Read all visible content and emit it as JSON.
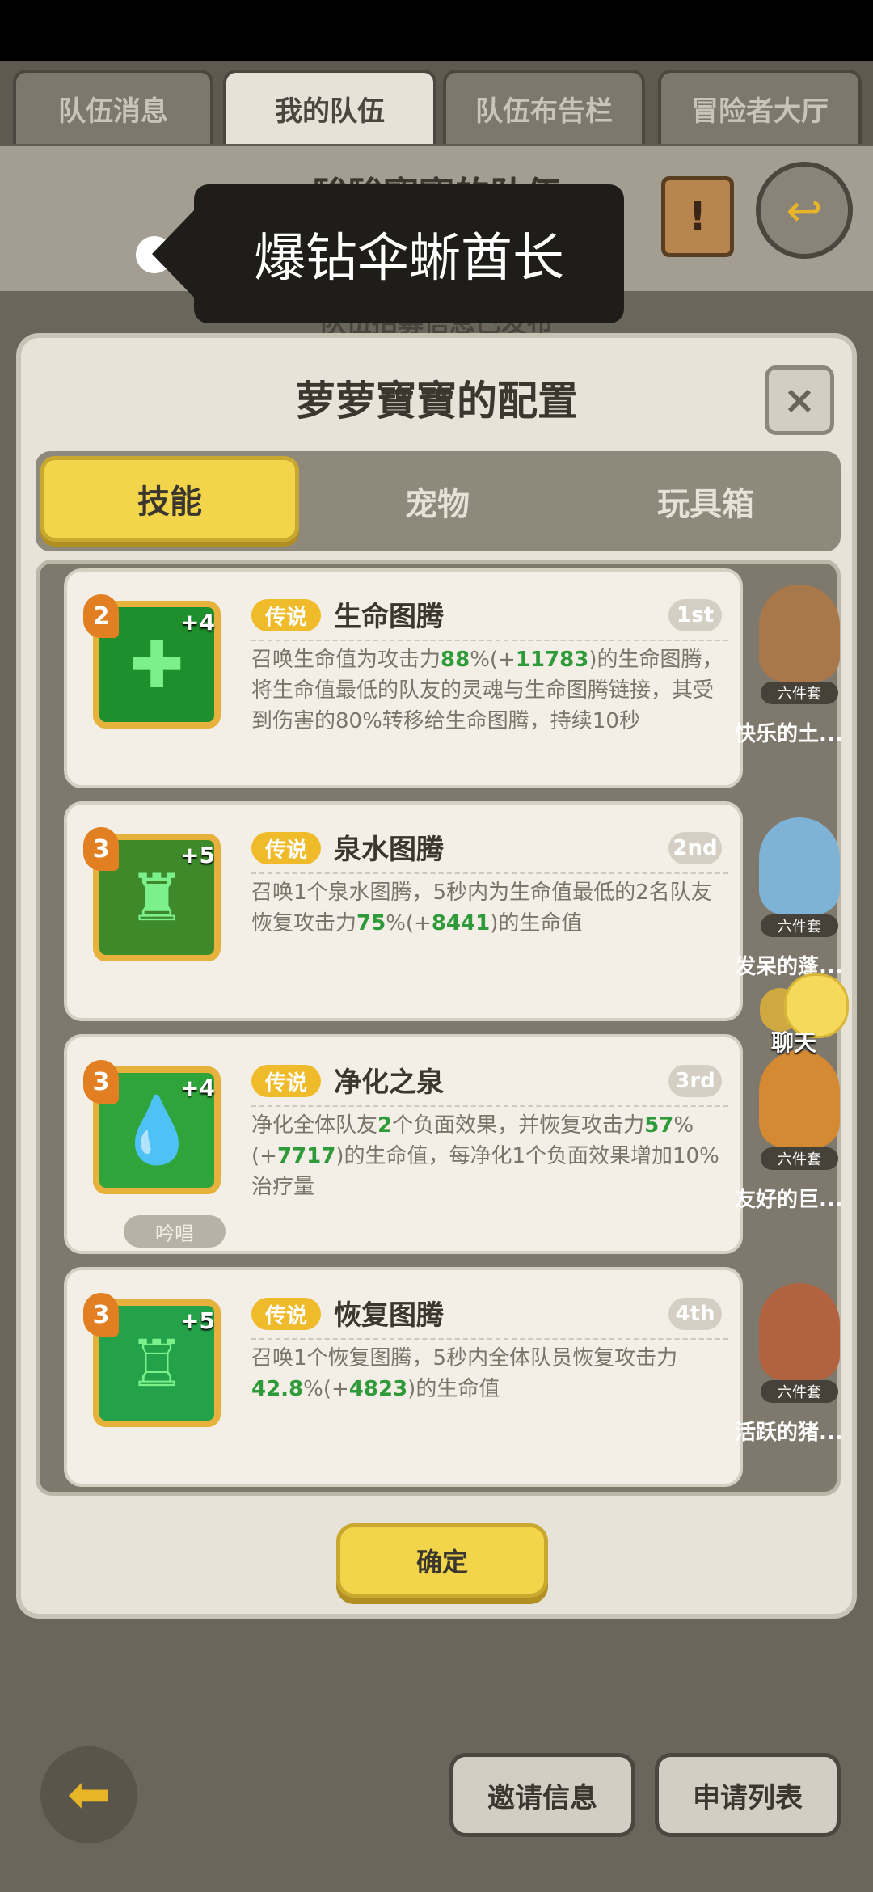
{
  "tabs": [
    {
      "label": "队伍消息",
      "active": false
    },
    {
      "label": "我的队伍",
      "active": true
    },
    {
      "label": "队伍布告栏",
      "active": false
    },
    {
      "label": "冒险者大厅",
      "active": false
    }
  ],
  "header": {
    "team_title": "駿駿寶寶的队伍",
    "team_status": "队伍招募信息已发布"
  },
  "tooltip": {
    "text": "爆钻伞蜥酋长"
  },
  "modal": {
    "title": "萝萝寶寶的配置",
    "close_label": "×",
    "segments": [
      {
        "label": "技能",
        "active": true
      },
      {
        "label": "宠物",
        "active": false
      },
      {
        "label": "玩具箱",
        "active": false
      }
    ],
    "skills": [
      {
        "level": "2",
        "plus": "+4",
        "rarity": "传说",
        "name": "生命图腾",
        "rank": "1st",
        "desc_parts": [
          "召唤生命值为攻击力",
          "88",
          "%(+",
          "11783",
          ")的生命图腾，将生命值最低的队友的灵魂与生命图腾链接，其受到伤害的80%转移给生命图腾，持续10秒"
        ],
        "pet_name": "快乐的土...",
        "pet_tag": "六件套",
        "chant": ""
      },
      {
        "level": "3",
        "plus": "+5",
        "rarity": "传说",
        "name": "泉水图腾",
        "rank": "2nd",
        "desc_parts": [
          "召唤1个泉水图腾，5秒内为生命值最低的2名队友恢复攻击力",
          "75",
          "%(+",
          "8441",
          ")的生命值"
        ],
        "pet_name": "发呆的蓬...",
        "pet_tag": "六件套",
        "chant": ""
      },
      {
        "level": "3",
        "plus": "+4",
        "rarity": "传说",
        "name": "净化之泉",
        "rank": "3rd",
        "desc_parts": [
          "净化全体队友",
          "2",
          "个负面效果，并恢复攻击力",
          "57",
          "%(+",
          "7717",
          ")的生命值，每净化1个负面效果增加10%治疗量"
        ],
        "pet_name": "友好的巨...",
        "pet_tag": "六件套",
        "chant": "吟唱"
      },
      {
        "level": "3",
        "plus": "+5",
        "rarity": "传说",
        "name": "恢复图腾",
        "rank": "4th",
        "desc_parts": [
          "召唤1个恢复图腾，5秒内全体队员恢复攻击力",
          "42.8",
          "%(+",
          "4823",
          ")的生命值"
        ],
        "pet_name": "活跃的猪...",
        "pet_tag": "六件套",
        "chant": ""
      }
    ],
    "confirm_label": "确定"
  },
  "chat": {
    "label": "聊天"
  },
  "bottom": {
    "invite_label": "邀请信息",
    "apply_label": "申请列表"
  },
  "colors": {
    "accent_yellow": "#f3d54b",
    "highlight_green": "#2f9a3a",
    "rarity_gold": "#efbb2a"
  }
}
